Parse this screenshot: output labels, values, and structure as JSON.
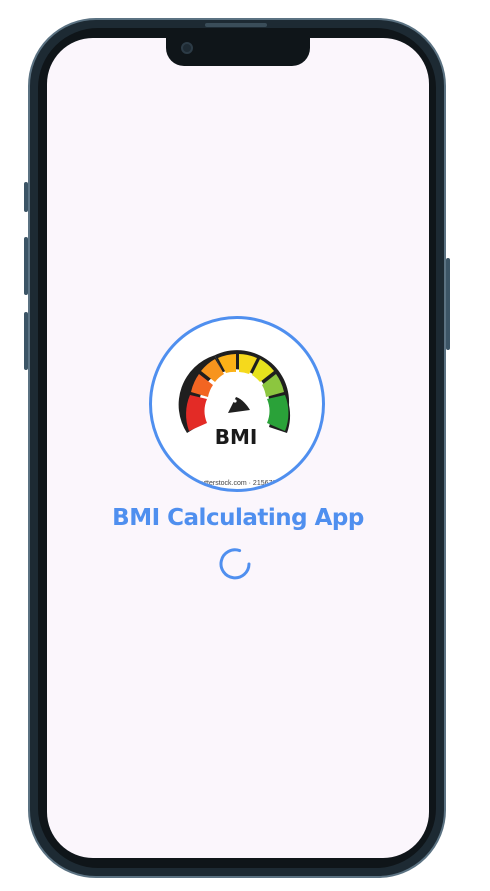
{
  "app": {
    "title": "BMI Calculating App"
  },
  "logo": {
    "label": "BMI",
    "watermark": "shutterstock.com · 2156735"
  },
  "loading": {
    "indicator": "spinner"
  },
  "colors": {
    "accent": "#4f8fef",
    "screen_background": "#fbf6fc",
    "phone_frame": "#1d2a33",
    "gauge_red": "#e32b26",
    "gauge_orange": "#f47c20",
    "gauge_yellow": "#f5d91c",
    "gauge_green": "#2aa239"
  }
}
